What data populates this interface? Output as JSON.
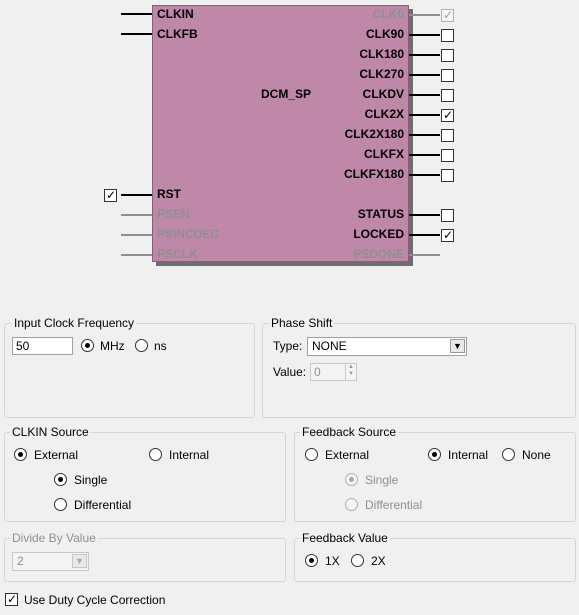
{
  "diagram": {
    "title": "DCM_SP",
    "left_pins": [
      {
        "name": "CLKIN",
        "enabled": true
      },
      {
        "name": "CLKFB",
        "enabled": true
      },
      {
        "name": "RST",
        "enabled": true,
        "checked": true
      },
      {
        "name": "PSEN",
        "enabled": false
      },
      {
        "name": "PSINCDEC",
        "enabled": false
      },
      {
        "name": "PSCLK",
        "enabled": false
      }
    ],
    "right_pins": [
      {
        "name": "CLK0",
        "enabled": false,
        "checked": true
      },
      {
        "name": "CLK90",
        "enabled": true,
        "checked": false
      },
      {
        "name": "CLK180",
        "enabled": true,
        "checked": false
      },
      {
        "name": "CLK270",
        "enabled": true,
        "checked": false
      },
      {
        "name": "CLKDV",
        "enabled": true,
        "checked": false
      },
      {
        "name": "CLK2X",
        "enabled": true,
        "checked": true
      },
      {
        "name": "CLK2X180",
        "enabled": true,
        "checked": false
      },
      {
        "name": "CLKFX",
        "enabled": true,
        "checked": false
      },
      {
        "name": "CLKFX180",
        "enabled": true,
        "checked": false
      },
      {
        "name": "STATUS",
        "enabled": true,
        "checked": false
      },
      {
        "name": "LOCKED",
        "enabled": true,
        "checked": true
      },
      {
        "name": "PSDONE",
        "enabled": false
      }
    ]
  },
  "input_clock": {
    "title": "Input Clock Frequency",
    "value": "50",
    "unit_mhz": "MHz",
    "unit_ns": "ns",
    "selected_unit": "MHz"
  },
  "phase_shift": {
    "title": "Phase Shift",
    "type_label": "Type:",
    "type_value": "NONE",
    "value_label": "Value:",
    "value": "0"
  },
  "clkin_source": {
    "title": "CLKIN Source",
    "external": "External",
    "internal": "Internal",
    "single": "Single",
    "differential": "Differential",
    "selected_source": "External",
    "selected_mode": "Single"
  },
  "feedback_source": {
    "title": "Feedback Source",
    "external": "External",
    "internal": "Internal",
    "none": "None",
    "single": "Single",
    "differential": "Differential",
    "selected_source": "Internal",
    "selected_mode": "Single"
  },
  "divide_by": {
    "title": "Divide By Value",
    "value": "2"
  },
  "feedback_value": {
    "title": "Feedback Value",
    "opt_1x": "1X",
    "opt_2x": "2X",
    "selected": "1X"
  },
  "duty_cycle": {
    "label": "Use Duty Cycle Correction",
    "checked": true
  },
  "icons": {
    "check": "✓",
    "dropdown": "▼",
    "spin_up": "▲",
    "spin_down": "▼"
  },
  "colors": {
    "block_fill": "#bf88a8",
    "disabled_text": "#8f8f8f"
  }
}
